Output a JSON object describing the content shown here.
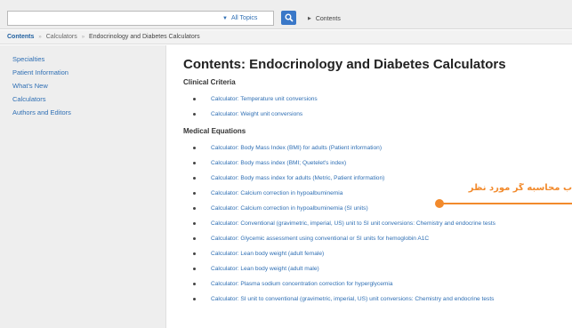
{
  "search": {
    "placeholder": "",
    "topics_label": "All Topics",
    "contents_label": "Contents"
  },
  "breadcrumb": {
    "items": [
      "Contents",
      "Calculators",
      "Endocrinology and Diabetes Calculators"
    ]
  },
  "sidebar": {
    "items": [
      {
        "label": "Specialties"
      },
      {
        "label": "Patient Information"
      },
      {
        "label": "What's New"
      },
      {
        "label": "Calculators"
      },
      {
        "label": "Authors and Editors"
      }
    ]
  },
  "main": {
    "title": "Contents: Endocrinology and Diabetes Calculators",
    "sections": [
      {
        "heading": "Clinical Criteria",
        "items": [
          "Calculator: Temperature unit conversions",
          "Calculator: Weight unit conversions"
        ]
      },
      {
        "heading": "Medical Equations",
        "items": [
          "Calculator: Body Mass Index (BMI) for adults (Patient information)",
          "Calculator: Body mass index (BMI; Quetelet's index)",
          "Calculator: Body mass index for adults (Metric, Patient information)",
          "Calculator: Calcium correction in hypoalbuminemia",
          "Calculator: Calcium correction in hypoalbuminemia (SI units)",
          "Calculator: Conventional (gravimetric, imperial, US) unit to SI unit conversions: Chemistry and endocrine tests",
          "Calculator: Glycemic assessment using conventional or SI units for hemoglobin A1C",
          "Calculator: Lean body weight (adult female)",
          "Calculator: Lean body weight (adult male)",
          "Calculator: Plasma sodium concentration correction for hyperglycemia",
          "Calculator: SI unit to conventional (gravimetric, imperial, US) unit conversions: Chemistry and endocrine tests"
        ]
      }
    ]
  },
  "annotation": {
    "text": "ب محاسبه گر مورد نظر",
    "color": "#f28a2c"
  },
  "colors": {
    "link": "#2f6fb4",
    "search_button": "#3a78c8",
    "sidebar_bg": "#eeeeee"
  }
}
